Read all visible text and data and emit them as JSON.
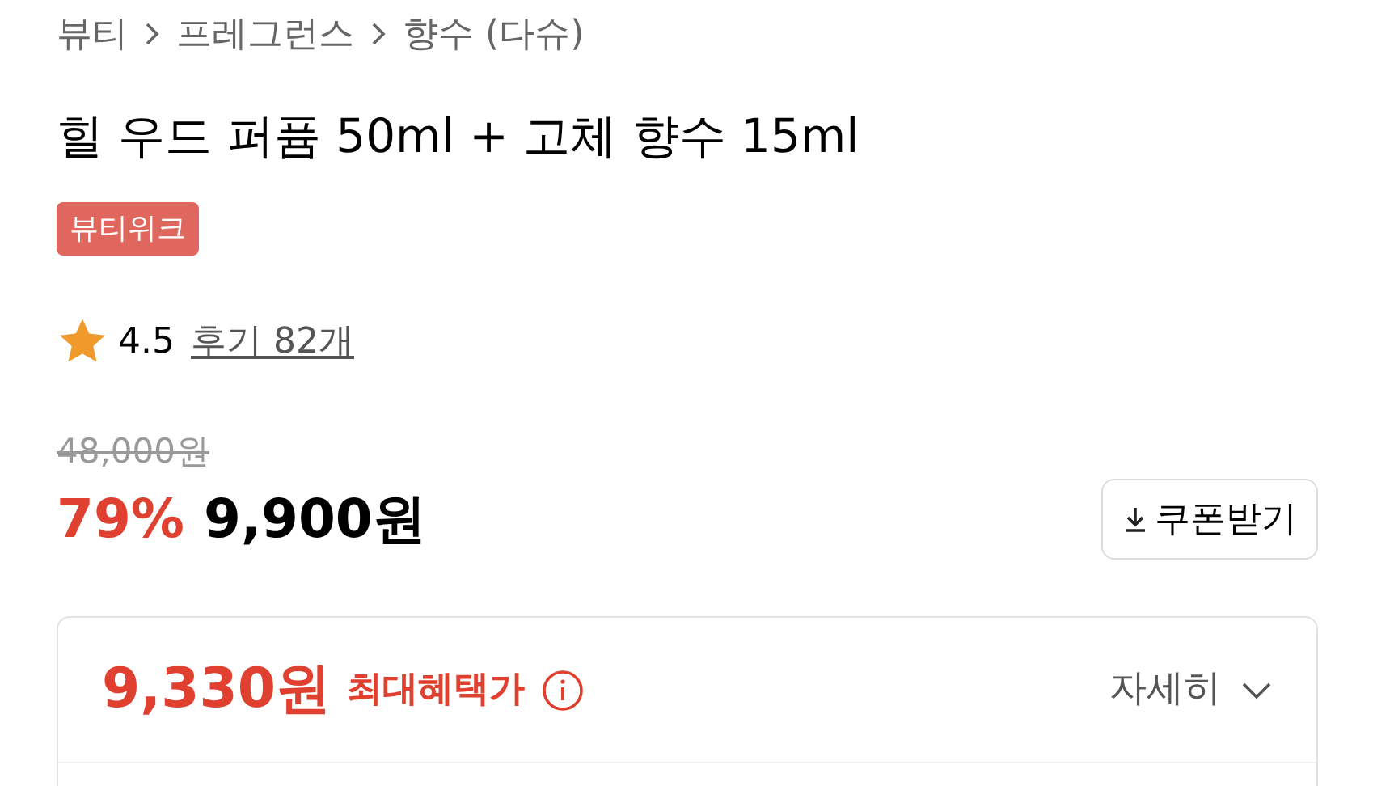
{
  "breadcrumb": [
    "뷰티",
    "프레그런스",
    "향수 (다슈)"
  ],
  "title": "힐 우드 퍼퓸 50ml + 고체 향수 15ml",
  "badge": {
    "label": "뷰티위크",
    "color": "#e0675e"
  },
  "rating": {
    "score": "4.5",
    "reviews": "후기 82개"
  },
  "price": {
    "original": "48,000원",
    "discount": "79%",
    "sale": "9,900원"
  },
  "coupon_button": "쿠폰받기",
  "benefit": {
    "price": "9,330원",
    "label": "최대혜택가",
    "details": "자세히"
  }
}
